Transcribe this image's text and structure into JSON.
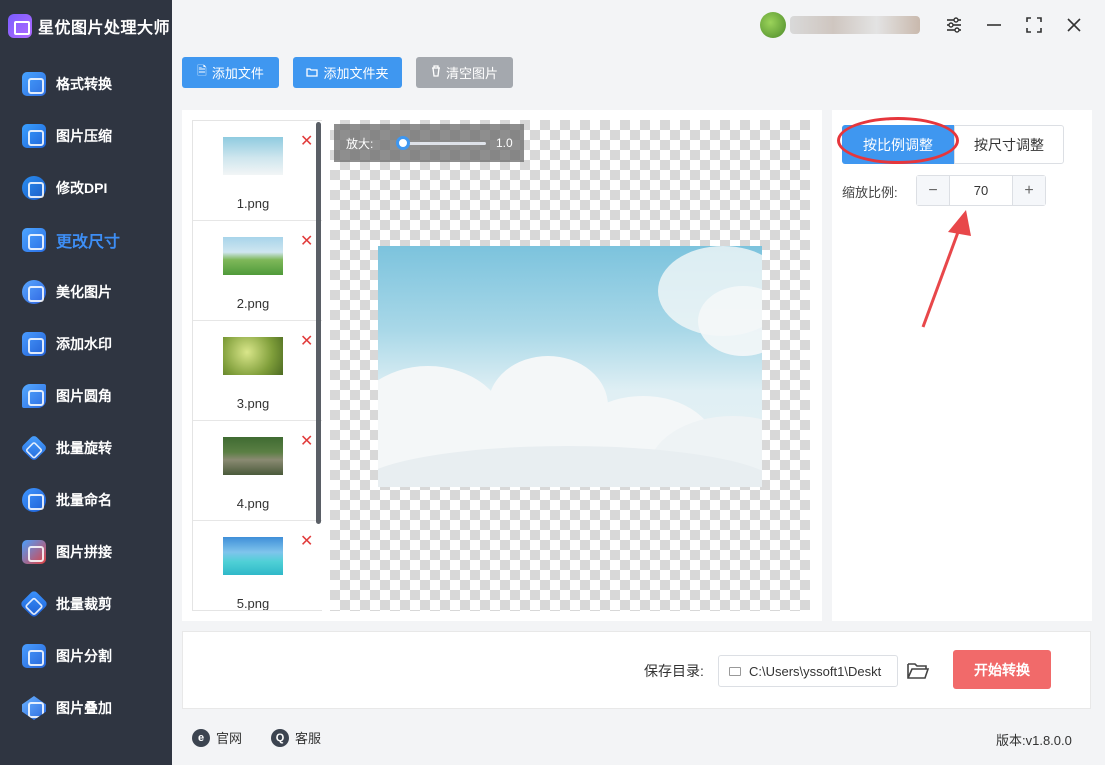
{
  "app": {
    "title": "星优图片处理大师"
  },
  "sidebar": {
    "items": [
      {
        "label": "格式转换",
        "icon": "format-convert-icon"
      },
      {
        "label": "图片压缩",
        "icon": "compress-icon"
      },
      {
        "label": "修改DPI",
        "icon": "dpi-icon"
      },
      {
        "label": "更改尺寸",
        "icon": "resize-icon",
        "active": true
      },
      {
        "label": "美化图片",
        "icon": "beautify-icon"
      },
      {
        "label": "添加水印",
        "icon": "watermark-icon"
      },
      {
        "label": "图片圆角",
        "icon": "round-corner-icon"
      },
      {
        "label": "批量旋转",
        "icon": "rotate-icon"
      },
      {
        "label": "批量命名",
        "icon": "rename-icon"
      },
      {
        "label": "图片拼接",
        "icon": "stitch-icon"
      },
      {
        "label": "批量裁剪",
        "icon": "crop-icon"
      },
      {
        "label": "图片分割",
        "icon": "split-icon"
      },
      {
        "label": "图片叠加",
        "icon": "overlay-icon"
      }
    ]
  },
  "toolbar": {
    "add_file": "添加文件",
    "add_folder": "添加文件夹",
    "clear": "清空图片"
  },
  "files": [
    {
      "name": "1.png"
    },
    {
      "name": "2.png"
    },
    {
      "name": "3.png"
    },
    {
      "name": "4.png"
    },
    {
      "name": "5.png"
    }
  ],
  "preview": {
    "zoom_label": "放大:",
    "zoom_value": "1.0"
  },
  "resize": {
    "tab_ratio": "按比例调整",
    "tab_size": "按尺寸调整",
    "scale_label": "缩放比例:",
    "scale_value": "70",
    "minus": "−",
    "plus": "+"
  },
  "output": {
    "save_label": "保存目录:",
    "save_path": "C:\\Users\\yssoft1\\Deskt",
    "start_button": "开始转换"
  },
  "footer": {
    "website": "官网",
    "support": "客服",
    "version": "版本:v1.8.0.0"
  },
  "colors": {
    "sidebar_bg": "#2f3541",
    "accent": "#3f97f0",
    "start_button": "#f16a6a",
    "delete": "#e23c3c",
    "highlight_ring": "#e6363c"
  }
}
